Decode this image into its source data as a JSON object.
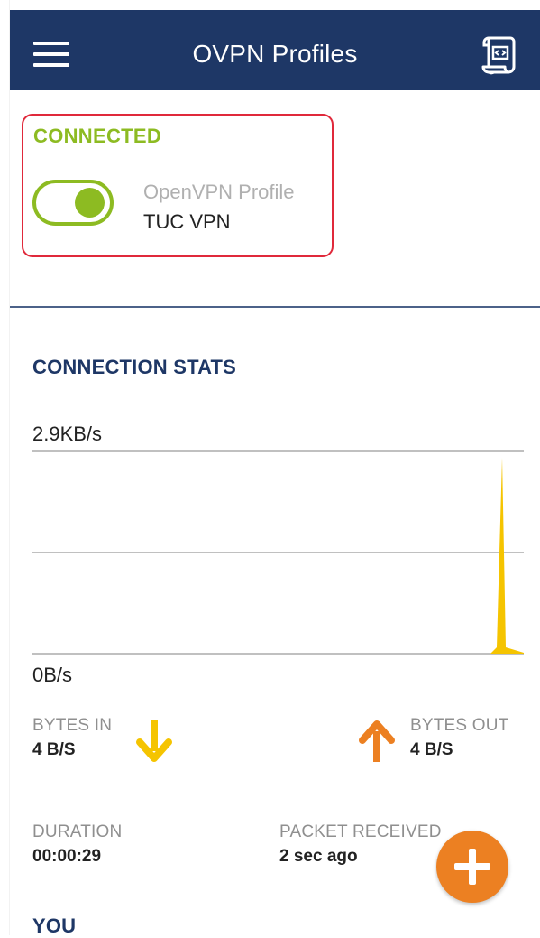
{
  "appbar": {
    "title": "OVPN Profiles",
    "menu_icon": "hamburger-menu-icon",
    "import_icon": "import-file-icon"
  },
  "connection": {
    "status": "CONNECTED",
    "toggle_on": true,
    "profile_type": "OpenVPN Profile",
    "profile_name": "TUC VPN"
  },
  "stats": {
    "title": "CONNECTION STATS",
    "chart_max_label": "2.9KB/s",
    "chart_min_label": "0B/s",
    "bytes_in_label": "BYTES IN",
    "bytes_in_value": "4 B/S",
    "bytes_out_label": "BYTES OUT",
    "bytes_out_value": "4 B/S",
    "duration_label": "DURATION",
    "duration_value": "00:00:29",
    "packet_label": "PACKET RECEIVED",
    "packet_value": "2 sec ago"
  },
  "you_section": {
    "title": "YOU"
  },
  "fab": {
    "icon": "plus-icon"
  },
  "colors": {
    "appbar": "#1e3766",
    "connected_green": "#8dbb22",
    "highlight_red": "#e0293b",
    "bytes_in_yellow": "#f5c400",
    "bytes_out_orange": "#ec8022",
    "fab_orange": "#ec8022"
  }
}
